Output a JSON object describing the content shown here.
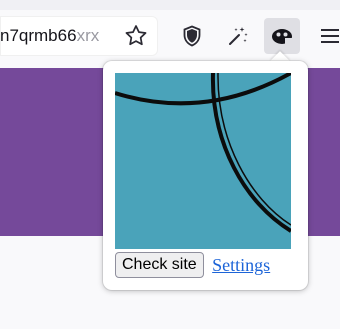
{
  "address_bar": {
    "url_visible": "n7qrmb66",
    "url_faded": "xrx"
  },
  "toolbar": {
    "icons": [
      "star-icon",
      "shield-icon",
      "magic-wand-icon",
      "extension-icon",
      "menu-icon"
    ]
  },
  "popup": {
    "check_button_label": "Check site",
    "settings_link_label": "Settings"
  },
  "colors": {
    "page_accent": "#75499a",
    "preview_background": "#4aa3ba",
    "link": "#1c64d8"
  }
}
